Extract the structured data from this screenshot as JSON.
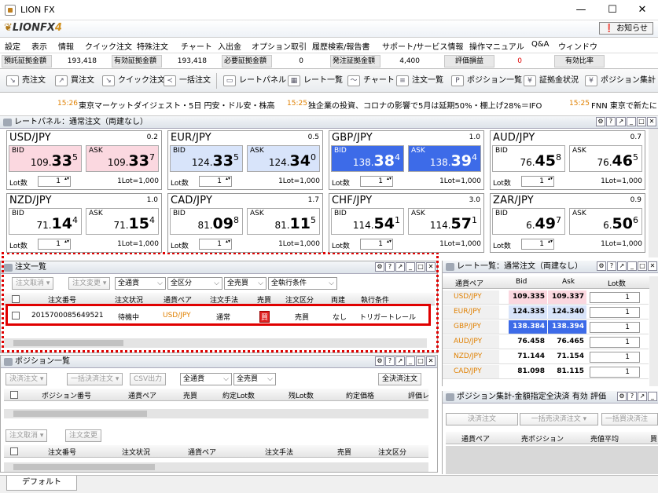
{
  "titlebar": {
    "title": "LION FX",
    "min": "—",
    "max": "☐",
    "close": "✕"
  },
  "logo": {
    "text": "LIONFX",
    "suffix": "4"
  },
  "notice_label": "お知らせ",
  "menu": [
    "設定",
    "表示",
    "情報",
    "クイック注文",
    "特殊注文",
    "チャート",
    "入出金",
    "オプション取引",
    "履歴検索/報告書",
    "サポート/サービス情報",
    "操作マニュアル",
    "Q&A",
    "ウィンドウ"
  ],
  "status": [
    {
      "label": "預託証拠金額",
      "value": "193,418"
    },
    {
      "label": "有効証拠金額",
      "value": "193,418"
    },
    {
      "label": "必要証拠金額",
      "value": "0"
    },
    {
      "label": "発注証拠金額",
      "value": "4,400"
    },
    {
      "label": "評価損益",
      "value": "0",
      "color": "#e00000"
    },
    {
      "label": "有効比率",
      "value": ""
    }
  ],
  "toolbar": [
    "売注文",
    "買注文",
    "クイック注文",
    "一括注文",
    "レートパネル",
    "レート一覧",
    "チャート",
    "注文一覧",
    "ポジション一覧",
    "証拠金状況",
    "ポジション集計"
  ],
  "ticker": [
    {
      "time": "15:26",
      "text": "東京マーケットダイジェスト・5日 円安・ドル安・株高"
    },
    {
      "time": "15:25",
      "text": "独企業の投資、コロナの影響で5月は延期50%・棚上げ28%＝IFO"
    },
    {
      "time": "15:25",
      "text": "FNN 東京で新たに"
    }
  ],
  "rate_panel": {
    "title": "レートパネル：通常注文（両建なし）",
    "bid_label": "BID",
    "ask_label": "ASK",
    "lot_label": "Lot数",
    "lot_value": "1",
    "lot_unit": "1Lot=1,000",
    "pairs": [
      {
        "pair": "USD/JPY",
        "spread": "0.2",
        "bid": [
          "109.",
          "33",
          "5"
        ],
        "ask": [
          "109.",
          "33",
          "7"
        ],
        "style": "pink"
      },
      {
        "pair": "EUR/JPY",
        "spread": "0.5",
        "bid": [
          "124.",
          "33",
          "5"
        ],
        "ask": [
          "124.",
          "34",
          "0"
        ],
        "style": "light"
      },
      {
        "pair": "GBP/JPY",
        "spread": "1.0",
        "bid": [
          "138.",
          "38",
          "4"
        ],
        "ask": [
          "138.",
          "39",
          "4"
        ],
        "style": "dark"
      },
      {
        "pair": "AUD/JPY",
        "spread": "0.7",
        "bid": [
          "76.",
          "45",
          "8"
        ],
        "ask": [
          "76.",
          "46",
          "5"
        ],
        "style": "plain"
      },
      {
        "pair": "NZD/JPY",
        "spread": "1.0",
        "bid": [
          "71.",
          "14",
          "4"
        ],
        "ask": [
          "71.",
          "15",
          "4"
        ],
        "style": "plain"
      },
      {
        "pair": "CAD/JPY",
        "spread": "1.7",
        "bid": [
          "81.",
          "09",
          "8"
        ],
        "ask": [
          "81.",
          "11",
          "5"
        ],
        "style": "plain"
      },
      {
        "pair": "CHF/JPY",
        "spread": "3.0",
        "bid": [
          "114.",
          "54",
          "1"
        ],
        "ask": [
          "114.",
          "57",
          "1"
        ],
        "style": "plain"
      },
      {
        "pair": "ZAR/JPY",
        "spread": "0.9",
        "bid": [
          "6.",
          "49",
          "7"
        ],
        "ask": [
          "6.",
          "50",
          "6"
        ],
        "style": "plain"
      }
    ]
  },
  "order_list": {
    "title": "注文一覧",
    "btn_cancel": "注文取消",
    "btn_change": "注文変更",
    "filters": [
      "全通貨",
      "全区分",
      "全売買",
      "全執行条件"
    ],
    "headers": [
      "注文番号",
      "注文状況",
      "通貨ペア",
      "注文手法",
      "売買",
      "注文区分",
      "両建",
      "執行条件"
    ],
    "row": {
      "id": "2015700085649521",
      "status": "待機中",
      "pair": "USD/JPY",
      "method": "通常",
      "side": "買",
      "kind": "売買",
      "hedge": "なし",
      "cond": "トリガートレール"
    }
  },
  "rate_list": {
    "title": "レート一覧：通常注文（両建なし）",
    "headers": [
      "通貨ペア",
      "Bid",
      "Ask",
      "Lot数"
    ],
    "rows": [
      {
        "pair": "USD/JPY",
        "bid": "109.335",
        "ask": "109.337",
        "lot": "1",
        "style": "pink"
      },
      {
        "pair": "EUR/JPY",
        "bid": "124.335",
        "ask": "124.340",
        "lot": "1",
        "style": "light"
      },
      {
        "pair": "GBP/JPY",
        "bid": "138.384",
        "ask": "138.394",
        "lot": "1",
        "style": "dark"
      },
      {
        "pair": "AUD/JPY",
        "bid": "76.458",
        "ask": "76.465",
        "lot": "1",
        "style": "plain"
      },
      {
        "pair": "NZD/JPY",
        "bid": "71.144",
        "ask": "71.154",
        "lot": "1",
        "style": "plain"
      },
      {
        "pair": "CAD/JPY",
        "bid": "81.098",
        "ask": "81.115",
        "lot": "1",
        "style": "plain"
      }
    ]
  },
  "position_list": {
    "title": "ポジション一覧",
    "btns": [
      "決済注文",
      "一括決済注文",
      "CSV出力"
    ],
    "filters": [
      "全通貨",
      "全売買"
    ],
    "all_settle": "全決済注文",
    "headers": [
      "ポジション番号",
      "通貨ペア",
      "売買",
      "約定Lot数",
      "残Lot数",
      "約定価格",
      "評価レ"
    ],
    "btn_cancel": "注文取消",
    "btn_change": "注文変更",
    "headers2": [
      "注文番号",
      "注文状況",
      "通貨ペア",
      "注文手法",
      "売買",
      "注文区分"
    ]
  },
  "position_summary": {
    "title": "ポジション集計-金額指定全決済 有効 評価",
    "btns": [
      "決済注文",
      "一括売決済注文",
      "一括買決済注"
    ],
    "headers": [
      "通貨ペア",
      "売ポジション",
      "売値平均",
      "買"
    ]
  },
  "tab": "デフォルト"
}
